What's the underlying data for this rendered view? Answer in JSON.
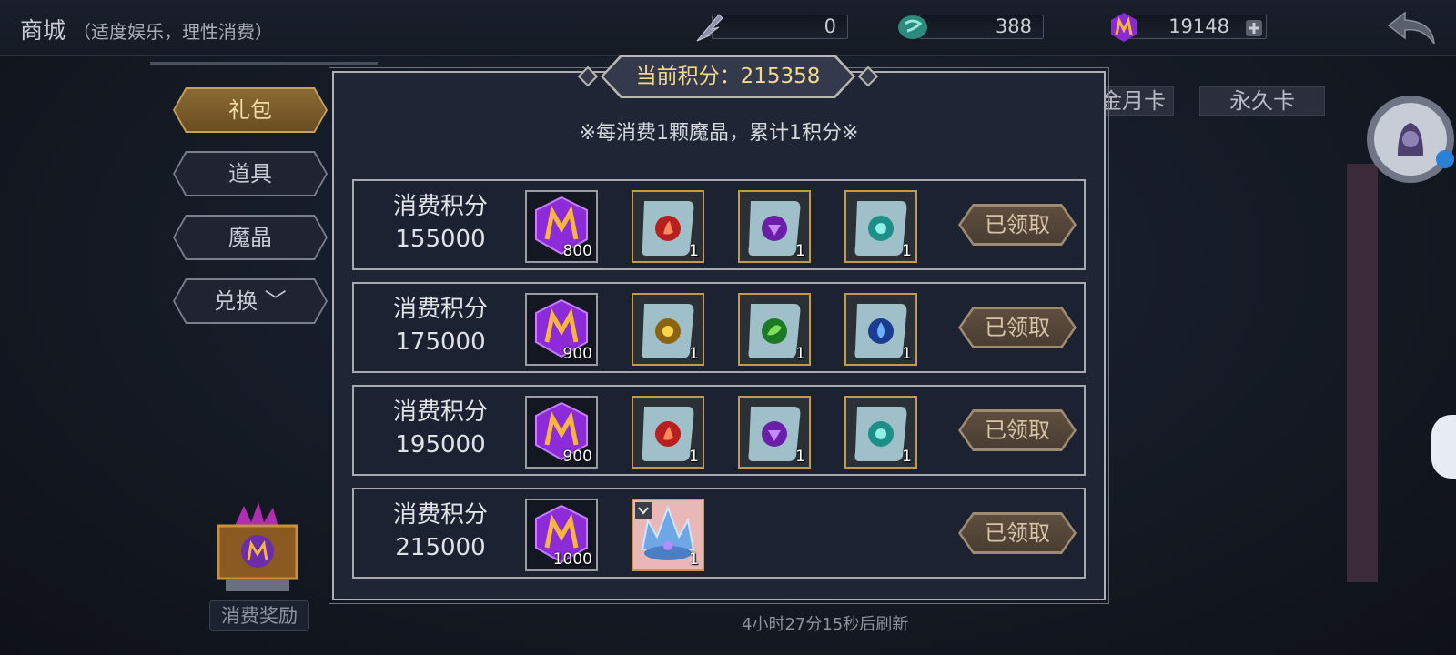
{
  "header": {
    "title": "商城",
    "subtitle": "（适度娱乐，理性消费）",
    "currencies": [
      {
        "icon": "feather-currency-icon",
        "value": "0"
      },
      {
        "icon": "orb-currency-icon",
        "value": "388"
      },
      {
        "icon": "magic-crystal-icon",
        "value": "19148"
      }
    ]
  },
  "menu": {
    "tabs": [
      {
        "label": "礼包",
        "active": true
      },
      {
        "label": "道具",
        "active": false
      },
      {
        "label": "魔晶",
        "active": false
      },
      {
        "label": "兑换 ﹀",
        "active": false
      }
    ]
  },
  "background_tabs": [
    "金月卡",
    "永久卡"
  ],
  "modal": {
    "score_label": "当前积分：215358",
    "rule": "※每消费1颗魔晶，累计1积分※",
    "rows": [
      {
        "label_line1": "消费积分",
        "label_line2": "155000",
        "gem_qty": "800",
        "items": [
          {
            "icon": "red-fire-scroll-icon",
            "qty": "1"
          },
          {
            "icon": "purple-scroll-icon",
            "qty": "1"
          },
          {
            "icon": "teal-scroll-icon",
            "qty": "1"
          }
        ],
        "button": "已领取"
      },
      {
        "label_line1": "消费积分",
        "label_line2": "175000",
        "gem_qty": "900",
        "items": [
          {
            "icon": "gold-sun-scroll-icon",
            "qty": "1"
          },
          {
            "icon": "green-leaf-scroll-icon",
            "qty": "1"
          },
          {
            "icon": "blue-water-scroll-icon",
            "qty": "1"
          }
        ],
        "button": "已领取"
      },
      {
        "label_line1": "消费积分",
        "label_line2": "195000",
        "gem_qty": "900",
        "items": [
          {
            "icon": "red-fire-scroll-icon",
            "qty": "1"
          },
          {
            "icon": "purple-scroll-icon",
            "qty": "1"
          },
          {
            "icon": "teal-scroll-icon",
            "qty": "1"
          }
        ],
        "button": "已领取"
      },
      {
        "label_line1": "消费积分",
        "label_line2": "215000",
        "gem_qty": "1000",
        "items": [
          {
            "icon": "ice-crown-icon",
            "qty": "1"
          }
        ],
        "button": "已领取"
      }
    ]
  },
  "footer": {
    "refresh": "4小时27分15秒后刷新",
    "bonus_label": "消费奖励"
  }
}
